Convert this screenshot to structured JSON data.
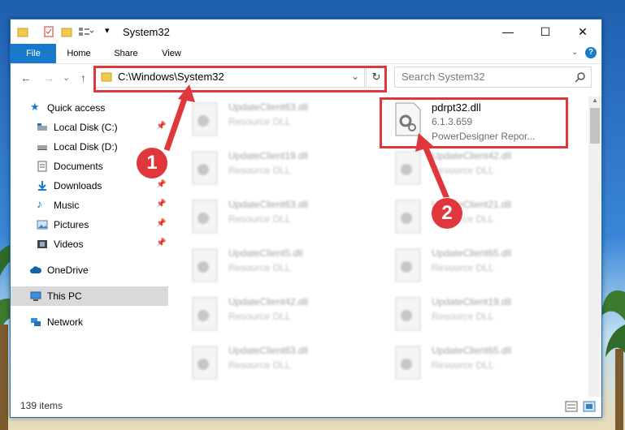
{
  "window": {
    "title": "System32",
    "controls": {
      "minimize": "—",
      "maximize": "☐",
      "close": "✕"
    }
  },
  "ribbon": {
    "tabs": [
      "File",
      "Home",
      "Share",
      "View"
    ]
  },
  "navigation": {
    "back": "←",
    "forward": "→",
    "dropdown": "⌄",
    "up": "↑",
    "address": "C:\\Windows\\System32",
    "refresh": "↻"
  },
  "search": {
    "placeholder": "Search System32"
  },
  "sidebar": {
    "items": [
      {
        "label": "Quick access",
        "icon": "star-icon"
      },
      {
        "label": "Local Disk (C:)",
        "icon": "drive-icon",
        "pinned": true
      },
      {
        "label": "Local Disk (D:)",
        "icon": "drive-icon"
      },
      {
        "label": "Documents",
        "icon": "document-icon",
        "pinned": true
      },
      {
        "label": "Downloads",
        "icon": "download-icon",
        "pinned": true
      },
      {
        "label": "Music",
        "icon": "music-icon",
        "pinned": true
      },
      {
        "label": "Pictures",
        "icon": "pictures-icon",
        "pinned": true
      },
      {
        "label": "Videos",
        "icon": "video-icon",
        "pinned": true
      },
      {
        "label": "OneDrive",
        "icon": "cloud-icon"
      },
      {
        "label": "This PC",
        "icon": "computer-icon",
        "selected": true
      },
      {
        "label": "Network",
        "icon": "network-icon"
      }
    ]
  },
  "files": {
    "left": [
      {
        "name": "UpdateClient63.dll",
        "type": "Resource DLL"
      },
      {
        "name": "UpdateClient19.dll",
        "type": "Resource DLL"
      },
      {
        "name": "UpdateClient63.dll",
        "type": "Resource DLL"
      },
      {
        "name": "UpdateClient5.dll",
        "type": "Resource DLL"
      },
      {
        "name": "UpdateClient42.dll",
        "type": "Resource DLL"
      },
      {
        "name": "UpdateClient63.dll",
        "type": "Resource DLL"
      }
    ],
    "right": [
      {
        "name": "pdrpt32.dll",
        "type": "6.1.3.659",
        "desc": "PowerDesigner Repor..."
      },
      {
        "name": "UpdateClient42.dll",
        "type": "Resource DLL"
      },
      {
        "name": "UpdateClient21.dll",
        "type": "Resource DLL"
      },
      {
        "name": "UpdateClient65.dll",
        "type": "Resource DLL"
      },
      {
        "name": "UpdateClient19.dll",
        "type": "Resource DLL"
      },
      {
        "name": "UpdateClient65.dll",
        "type": "Resource DLL"
      }
    ]
  },
  "status": {
    "item_count": "139 items"
  },
  "annotations": {
    "step1": "1",
    "step2": "2",
    "color": "#e0373d"
  }
}
